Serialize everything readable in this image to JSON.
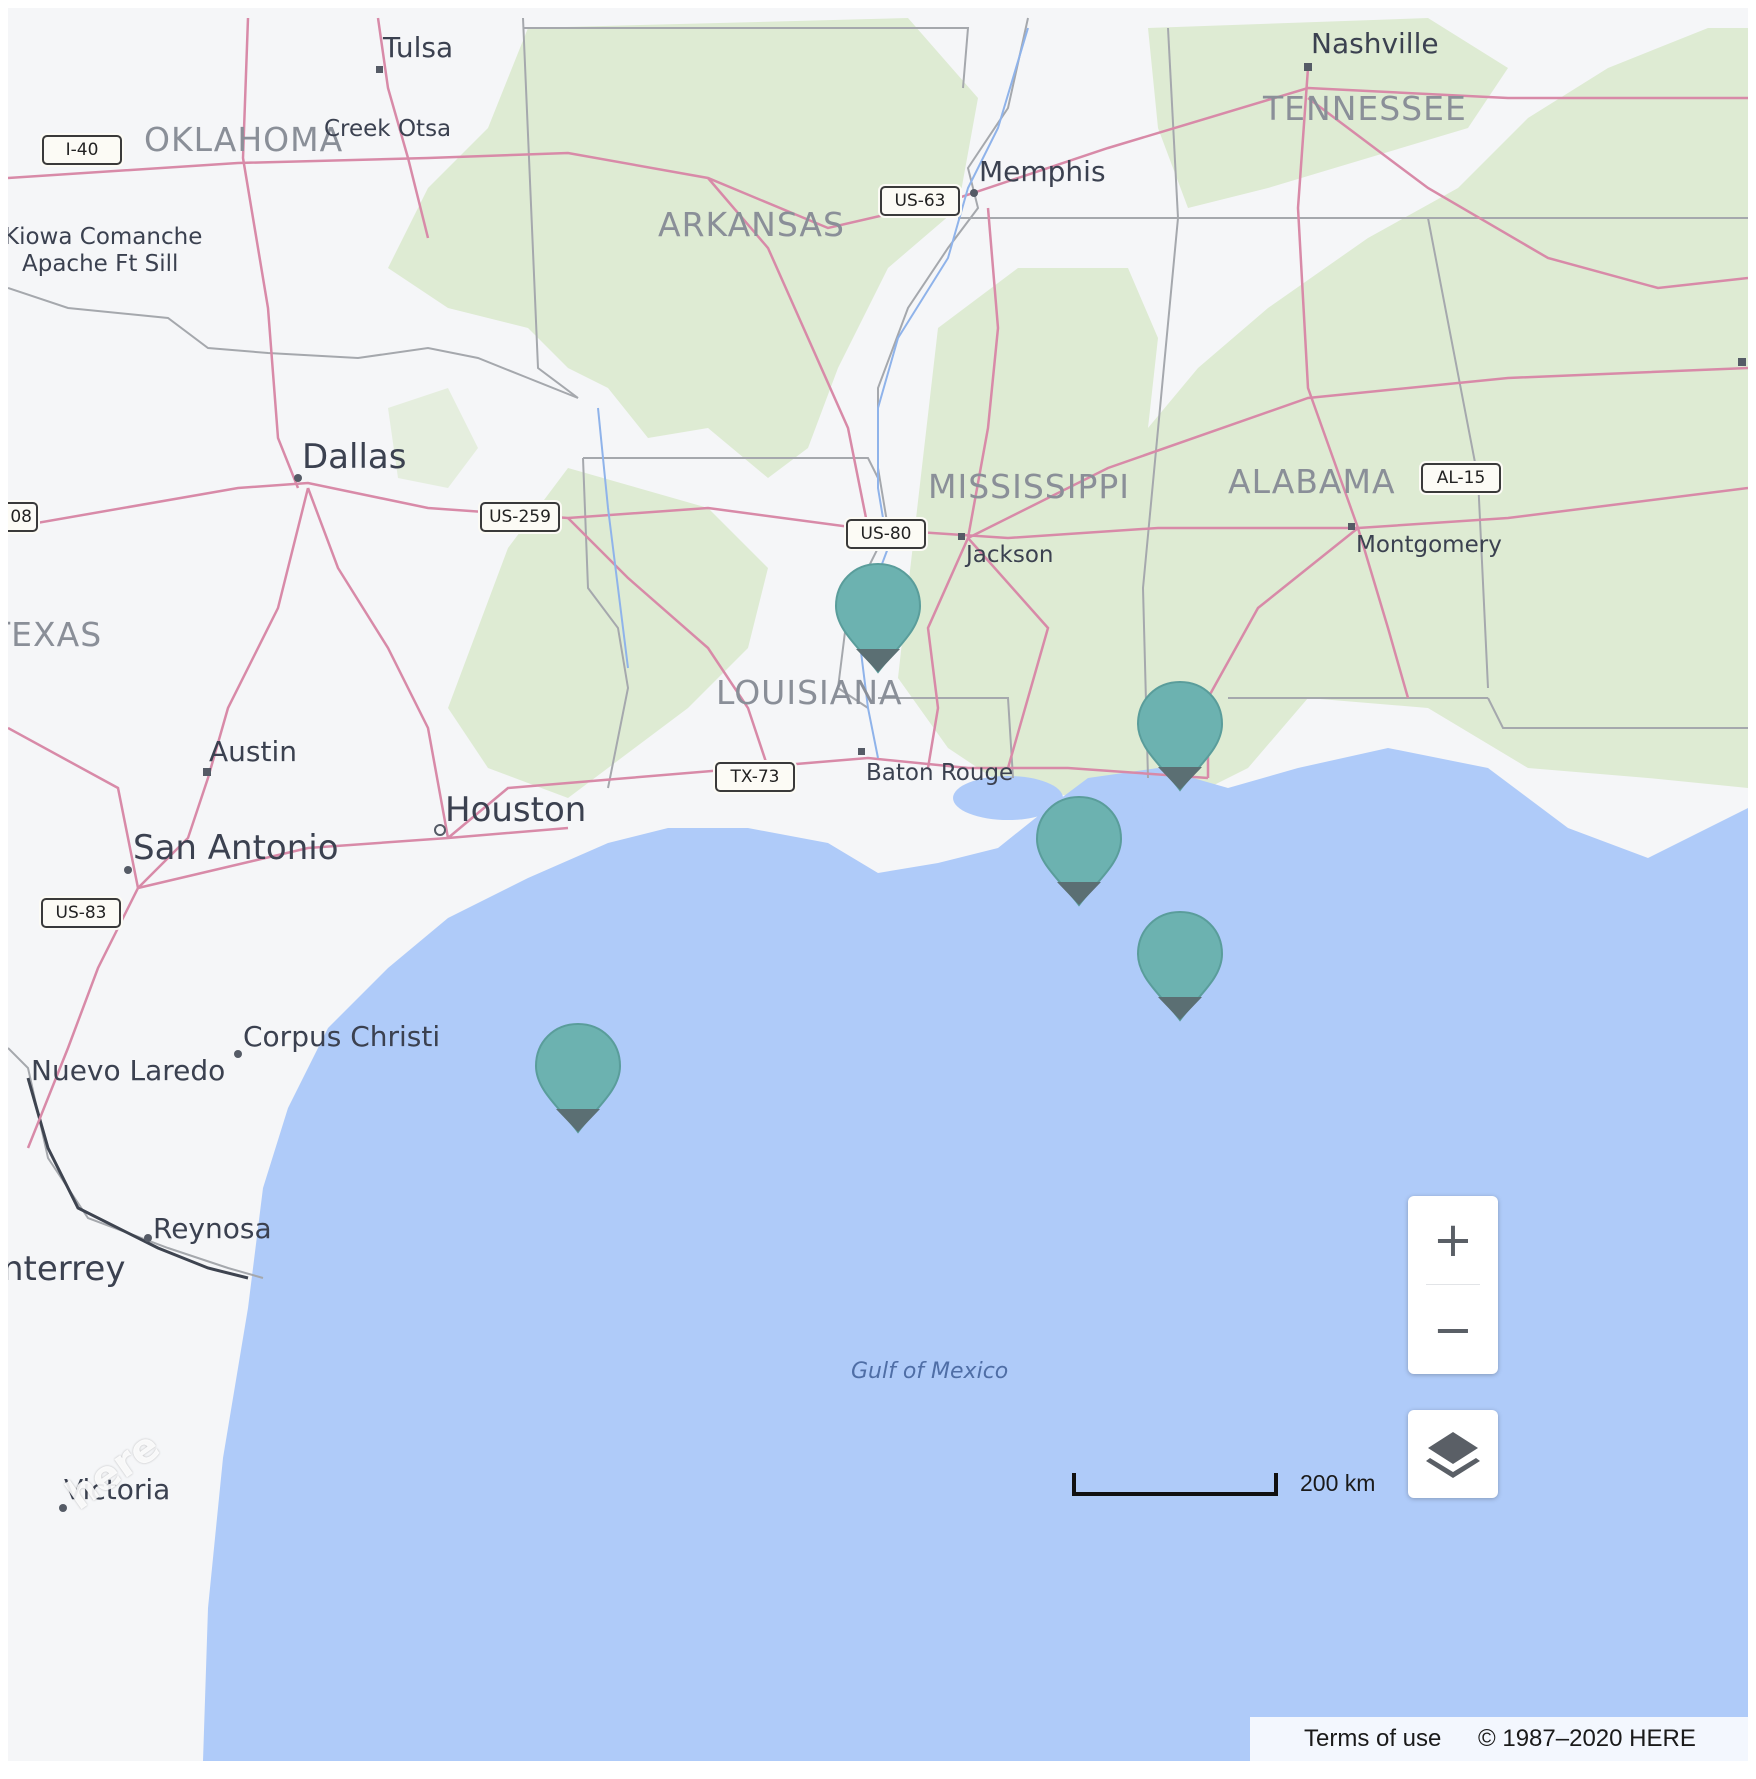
{
  "map": {
    "cities": [
      {
        "id": "tulsa",
        "name": "Tulsa",
        "size": "city"
      },
      {
        "id": "creek-otsa",
        "name": "Creek Otsa",
        "size": "city-sm"
      },
      {
        "id": "kiowa",
        "name": "Kiowa Comanche",
        "size": "city-sm"
      },
      {
        "id": "apache",
        "name": "Apache Ft Sill",
        "size": "city-sm"
      },
      {
        "id": "nashville",
        "name": "Nashville",
        "size": "city"
      },
      {
        "id": "memphis",
        "name": "Memphis",
        "size": "city"
      },
      {
        "id": "dallas",
        "name": "Dallas",
        "size": "city-big"
      },
      {
        "id": "jackson",
        "name": "Jackson",
        "size": "city-sm"
      },
      {
        "id": "montgomery",
        "name": "Montgomery",
        "size": "city-sm"
      },
      {
        "id": "austin",
        "name": "Austin",
        "size": "city"
      },
      {
        "id": "baton-rouge",
        "name": "Baton Rouge",
        "size": "city-sm"
      },
      {
        "id": "houston",
        "name": "Houston",
        "size": "city-big"
      },
      {
        "id": "san-antonio",
        "name": "San Antonio",
        "size": "city-big"
      },
      {
        "id": "corpus-christi",
        "name": "Corpus Christi",
        "size": "city"
      },
      {
        "id": "nuevo-laredo",
        "name": "Nuevo Laredo",
        "size": "city"
      },
      {
        "id": "reynosa",
        "name": "Reynosa",
        "size": "city"
      },
      {
        "id": "monterrey",
        "name": "nterrey",
        "size": "city-big"
      },
      {
        "id": "victoria",
        "name": "Victoria",
        "size": "city"
      }
    ],
    "states": [
      {
        "id": "oklahoma",
        "name": "OKLAHOMA"
      },
      {
        "id": "arkansas",
        "name": "ARKANSAS"
      },
      {
        "id": "tennessee",
        "name": "TENNESSEE"
      },
      {
        "id": "mississippi",
        "name": "MISSISSIPPI"
      },
      {
        "id": "alabama",
        "name": "ALABAMA"
      },
      {
        "id": "texas",
        "name": "TEXAS"
      },
      {
        "id": "louisiana",
        "name": "LOUISIANA"
      }
    ],
    "water_label": "Gulf of Mexico",
    "highway_shields": [
      {
        "id": "i-40",
        "label": "I-40"
      },
      {
        "id": "us-63",
        "label": "US-63"
      },
      {
        "id": "us-259",
        "label": "US-259"
      },
      {
        "id": "us-80",
        "label": "US-80"
      },
      {
        "id": "al-15",
        "label": "AL-15"
      },
      {
        "id": "tx-73",
        "label": "TX-73"
      },
      {
        "id": "us-83",
        "label": "US-83"
      },
      {
        "id": "edge",
        "label": "08"
      }
    ],
    "markers_count": 5,
    "marker_color": "#6cb2b0",
    "land_color": "#f5f6f8",
    "forest_color": "#deebd3",
    "water_color": "#afcbf9",
    "road_color": "#d88aa8"
  },
  "controls": {
    "zoom_in": "+",
    "zoom_out": "−"
  },
  "scale_bar": {
    "label": "200 km"
  },
  "footer": {
    "terms": "Terms of use",
    "copyright": "© 1987–2020 HERE"
  },
  "logo": {
    "text": "here"
  }
}
